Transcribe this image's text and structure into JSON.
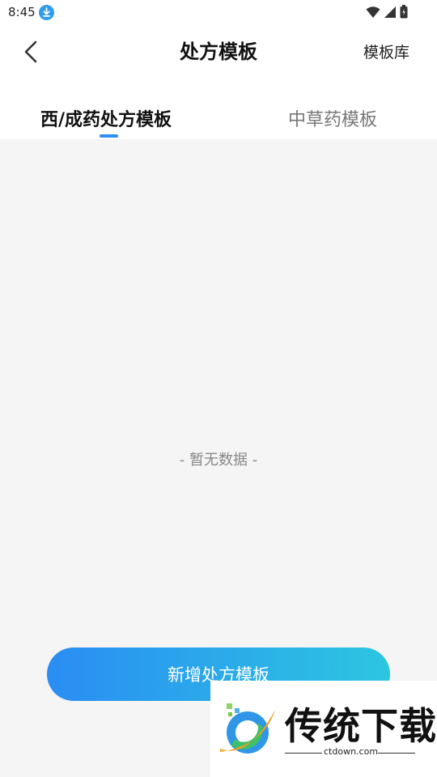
{
  "status_bar": {
    "time": "8:45",
    "icons": [
      "download-icon",
      "wifi-icon",
      "signal-icon",
      "battery-icon"
    ]
  },
  "header": {
    "title": "处方模板",
    "library_label": "模板库"
  },
  "tabs": [
    {
      "label": "西/成药处方模板",
      "active": true
    },
    {
      "label": "中草药模板",
      "active": false
    }
  ],
  "content": {
    "empty_text": "- 暂无数据 -"
  },
  "action": {
    "add_label": "新增处方模板"
  },
  "watermark": {
    "brand": "传统下载",
    "url": "ctdown.com"
  },
  "colors": {
    "accent": "#2e8ef5",
    "button_gradient_start": "#2a8df3",
    "button_gradient_end": "#2cc6e0",
    "content_background": "#f5f5f5"
  }
}
